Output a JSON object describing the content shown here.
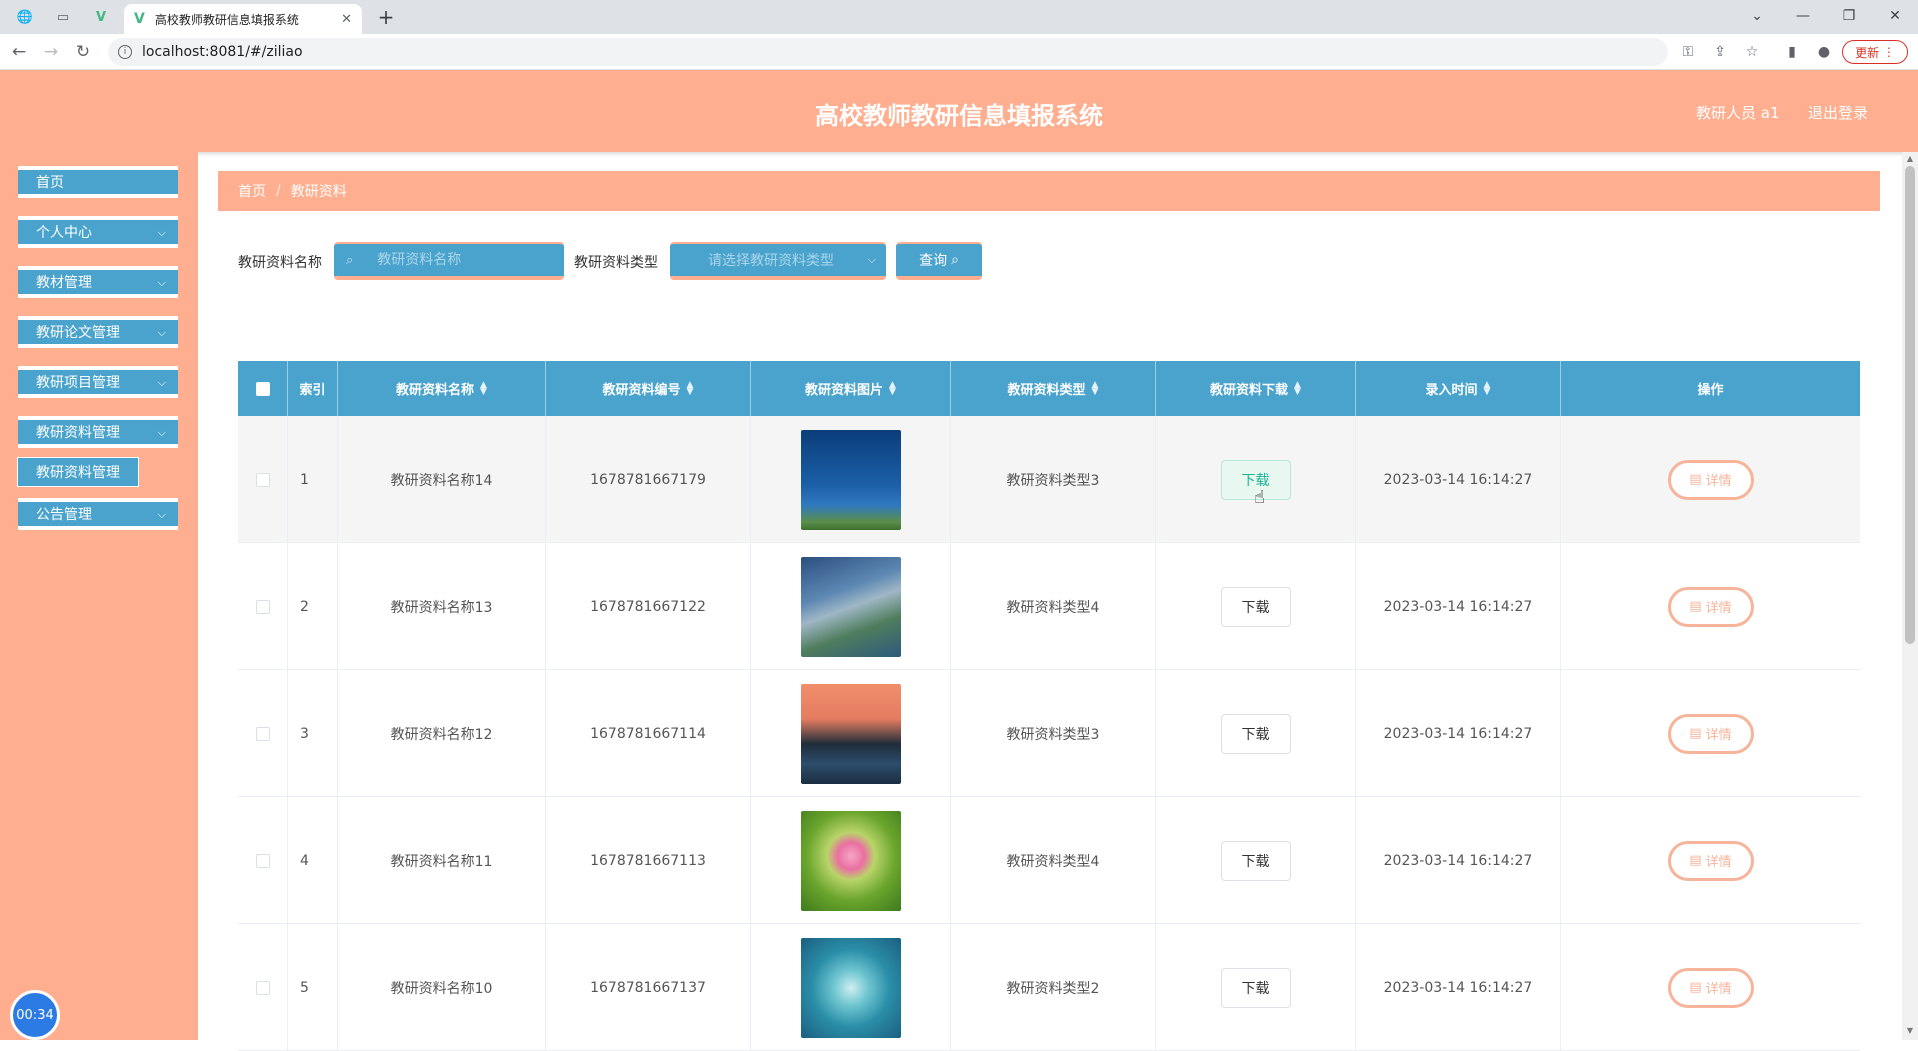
{
  "browser": {
    "tab_title": "高校教师教研信息填报系统",
    "url": "localhost:8081/#/ziliao",
    "update_label": "更新"
  },
  "header": {
    "title": "高校教师教研信息填报系统",
    "user": "教研人员 a1",
    "logout": "退出登录"
  },
  "sidebar": {
    "items": [
      {
        "label": "首页"
      },
      {
        "label": "个人中心"
      },
      {
        "label": "教材管理"
      },
      {
        "label": "教研论文管理"
      },
      {
        "label": "教研项目管理"
      },
      {
        "label": "教研资料管理"
      },
      {
        "label": "公告管理"
      }
    ],
    "submenu_label": "教研资料管理",
    "timer": "00:34"
  },
  "breadcrumb": {
    "home": "首页",
    "current": "教研资料"
  },
  "search": {
    "name_label": "教研资料名称",
    "name_placeholder": "教研资料名称",
    "type_label": "教研资料类型",
    "type_placeholder": "请选择教研资料类型",
    "query_label": "查询"
  },
  "table": {
    "headers": [
      "索引",
      "教研资料名称",
      "教研资料编号",
      "教研资料图片",
      "教研资料类型",
      "教研资料下载",
      "录入时间",
      "操作"
    ],
    "download_label": "下载",
    "detail_label": "详情",
    "rows": [
      {
        "index": "1",
        "name": "教研资料名称14",
        "code": "1678781667179",
        "type": "教研资料类型3",
        "time": "2023-03-14 16:14:27",
        "image": "ocean-figure-photo"
      },
      {
        "index": "2",
        "name": "教研资料名称13",
        "code": "1678781667122",
        "type": "教研资料类型4",
        "time": "2023-03-14 16:14:27",
        "image": "coast-aerial-photo"
      },
      {
        "index": "3",
        "name": "教研资料名称12",
        "code": "1678781667114",
        "type": "教研资料类型3",
        "time": "2023-03-14 16:14:27",
        "image": "sunset-lake-photo"
      },
      {
        "index": "4",
        "name": "教研资料名称11",
        "code": "1678781667113",
        "type": "教研资料类型4",
        "time": "2023-03-14 16:14:27",
        "image": "lotus-photo"
      },
      {
        "index": "5",
        "name": "教研资料名称10",
        "code": "1678781667137",
        "type": "教研资料类型2",
        "time": "2023-03-14 16:14:27",
        "image": "heart-island-photo"
      }
    ]
  },
  "colors": {
    "accent": "#ffaf8f",
    "primary": "#4aa3cc",
    "detail": "#f6b49a"
  }
}
